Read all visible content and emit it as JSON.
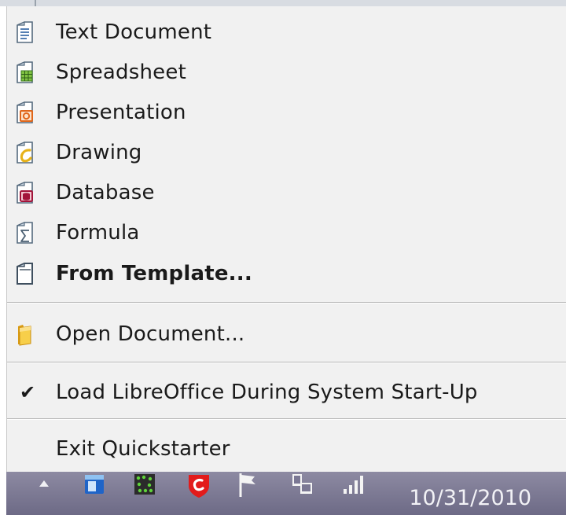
{
  "menu": {
    "items": [
      {
        "label": "Text Document",
        "icon": "text-document-icon"
      },
      {
        "label": "Spreadsheet",
        "icon": "spreadsheet-icon"
      },
      {
        "label": "Presentation",
        "icon": "presentation-icon"
      },
      {
        "label": "Drawing",
        "icon": "drawing-icon"
      },
      {
        "label": "Database",
        "icon": "database-icon"
      },
      {
        "label": "Formula",
        "icon": "formula-icon"
      },
      {
        "label": "From Template...",
        "icon": "template-icon"
      }
    ],
    "open_document": {
      "label": "Open Document...",
      "icon": "folder-icon"
    },
    "load_on_startup": {
      "label": "Load LibreOffice During System Start-Up",
      "checked": true
    },
    "exit": {
      "label": "Exit Quickstarter"
    }
  },
  "taskbar": {
    "clock": "10/31/2010",
    "tray_icons": [
      "show-hidden-icons-arrow-icon",
      "app-window-icon",
      "green-dots-icon",
      "red-shield-icon",
      "flag-icon",
      "network-icon",
      "signal-bars-icon"
    ]
  },
  "colors": {
    "menu_bg": "#f1f1f1",
    "separator": "#b5b5b5",
    "taskbar": "#7b7894",
    "text": "#1a1a1a"
  }
}
